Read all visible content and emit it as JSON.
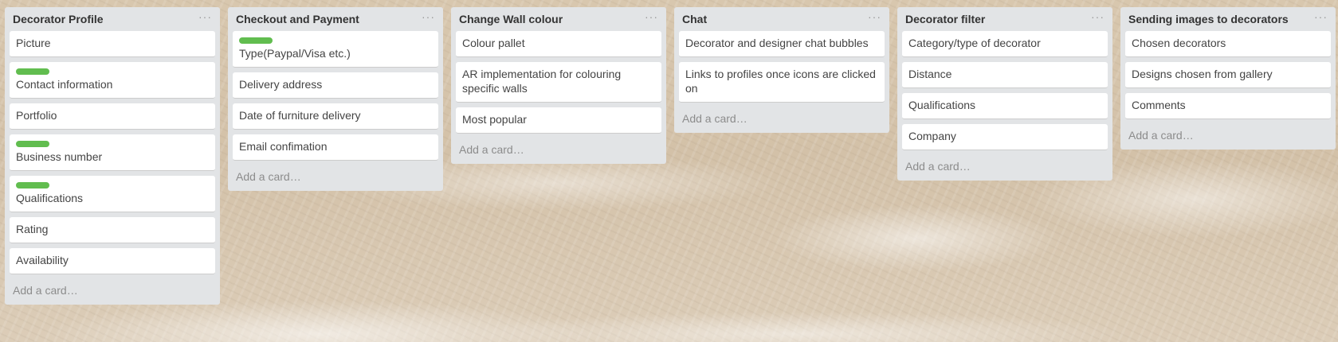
{
  "board": {
    "lists": [
      {
        "title": "Decorator Profile",
        "cards": [
          {
            "text": "Picture",
            "label": false
          },
          {
            "text": "Contact information",
            "label": true
          },
          {
            "text": "Portfolio",
            "label": false
          },
          {
            "text": "Business number",
            "label": true
          },
          {
            "text": "Qualifications",
            "label": true
          },
          {
            "text": "Rating",
            "label": false
          },
          {
            "text": "Availability",
            "label": false
          }
        ],
        "add_card": "Add a card…"
      },
      {
        "title": "Checkout and Payment",
        "cards": [
          {
            "text": "Type(Paypal/Visa etc.)",
            "label": true
          },
          {
            "text": "Delivery address",
            "label": false
          },
          {
            "text": "Date of furniture delivery",
            "label": false
          },
          {
            "text": "Email confimation",
            "label": false
          }
        ],
        "add_card": "Add a card…"
      },
      {
        "title": "Change Wall colour",
        "cards": [
          {
            "text": "Colour pallet",
            "label": false
          },
          {
            "text": "AR implementation for colouring specific walls",
            "label": false
          },
          {
            "text": "Most popular",
            "label": false
          }
        ],
        "add_card": "Add a card…"
      },
      {
        "title": "Chat",
        "cards": [
          {
            "text": "Decorator and designer chat bubbles",
            "label": false
          },
          {
            "text": "Links to profiles once icons are clicked on",
            "label": false
          }
        ],
        "add_card": "Add a card…"
      },
      {
        "title": "Decorator filter",
        "cards": [
          {
            "text": "Category/type of decorator",
            "label": false
          },
          {
            "text": "Distance",
            "label": false
          },
          {
            "text": "Qualifications",
            "label": false
          },
          {
            "text": "Company",
            "label": false
          }
        ],
        "add_card": "Add a card…"
      },
      {
        "title": "Sending images to decorators",
        "cards": [
          {
            "text": "Chosen decorators",
            "label": false
          },
          {
            "text": "Designs chosen from gallery",
            "label": false
          },
          {
            "text": "Comments",
            "label": false
          }
        ],
        "add_card": "Add a card…"
      }
    ],
    "list_menu_glyph": "···",
    "label_color": "#61bd4f"
  }
}
